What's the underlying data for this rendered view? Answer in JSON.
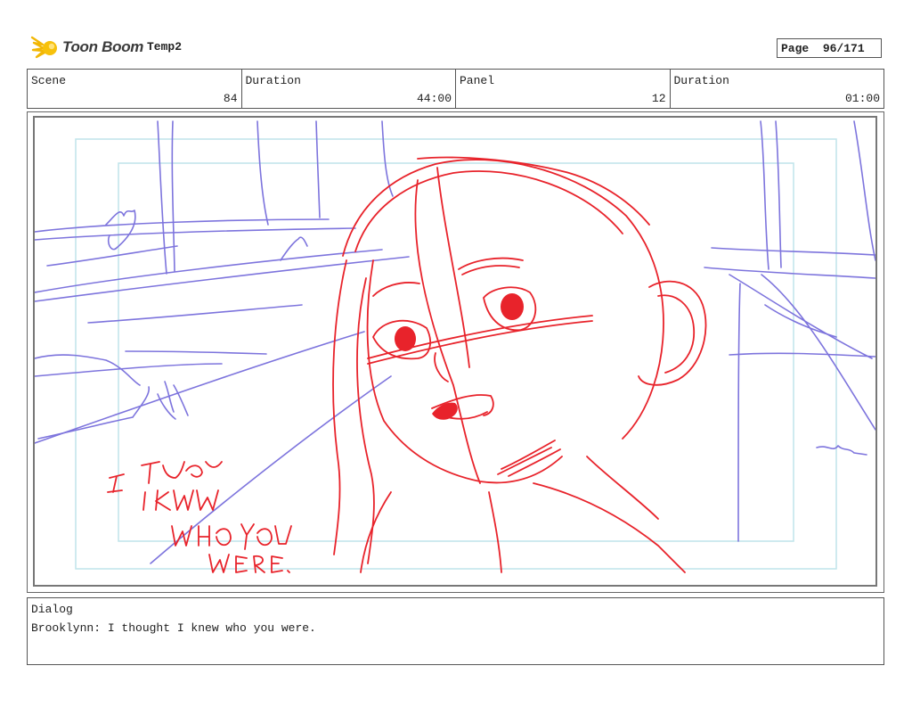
{
  "header": {
    "brand": "Toon Boom",
    "project": "Temp2",
    "page_label": "Page",
    "page_value": "96/171"
  },
  "info": {
    "scene_label": "Scene",
    "scene_value": "84",
    "duration_label": "Duration",
    "duration_value": "44:00",
    "panel_label": "Panel",
    "panel_value": "12",
    "panel_duration_label": "Duration",
    "panel_duration_value": "01:00"
  },
  "sketch": {
    "handwritten_note": "I THOUGHT I KNEW WHO YOU WERE.",
    "colors": {
      "character": "#e8232b",
      "background": "#7d74dd",
      "safe_frame": "#bfe4ea"
    }
  },
  "dialog": {
    "label": "Dialog",
    "text": "Brooklynn: I thought I knew who you were."
  }
}
